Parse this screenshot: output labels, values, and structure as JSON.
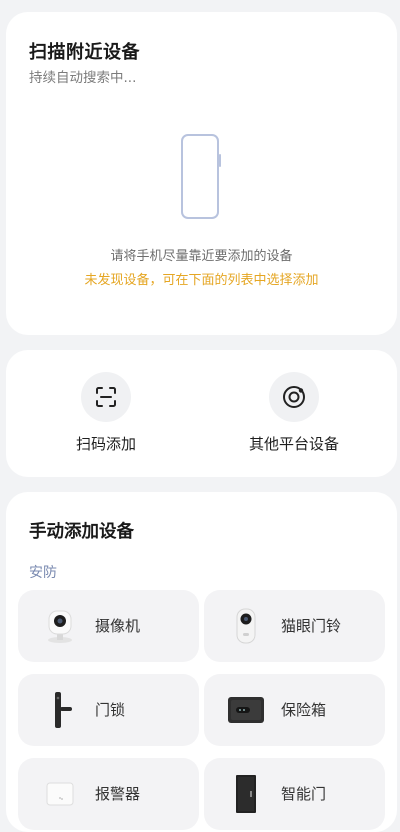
{
  "scan_nearby": {
    "title": "扫描附近设备",
    "status": "持续自动搜索中...",
    "hint": "请将手机尽量靠近要添加的设备",
    "warning": "未发现设备，可在下面的列表中选择添加",
    "warning_color": "#e5a623"
  },
  "actions": [
    {
      "label": "扫码添加",
      "icon": "scan-qr-icon"
    },
    {
      "label": "其他平台设备",
      "icon": "other-platform-icon"
    }
  ],
  "manual": {
    "title": "手动添加设备",
    "category": "安防",
    "devices": [
      {
        "label": "摄像机",
        "icon": "camera-icon"
      },
      {
        "label": "猫眼门铃",
        "icon": "peephole-doorbell-icon"
      },
      {
        "label": "门锁",
        "icon": "door-lock-icon"
      },
      {
        "label": "保险箱",
        "icon": "safe-box-icon"
      },
      {
        "label": "报警器",
        "icon": "alarm-icon"
      },
      {
        "label": "智能门",
        "icon": "smart-door-icon"
      }
    ]
  }
}
